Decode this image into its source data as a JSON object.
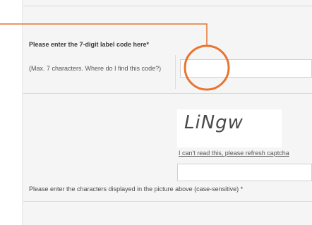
{
  "form": {
    "label_code_title": "Please enter the 7-digit label code here*",
    "label_code_hint": "(Max. 7 characters. Where do I find this code?)",
    "label_code_value": "",
    "captcha_text": "LiNgw",
    "refresh_link": "I can't read this, please refresh captcha",
    "captcha_value": "",
    "captcha_instruction": "Please enter the characters displayed in the picture above (case-sensitive) *"
  },
  "colors": {
    "annotation": "#e8742f",
    "panel_bg": "#f5f5f5"
  }
}
